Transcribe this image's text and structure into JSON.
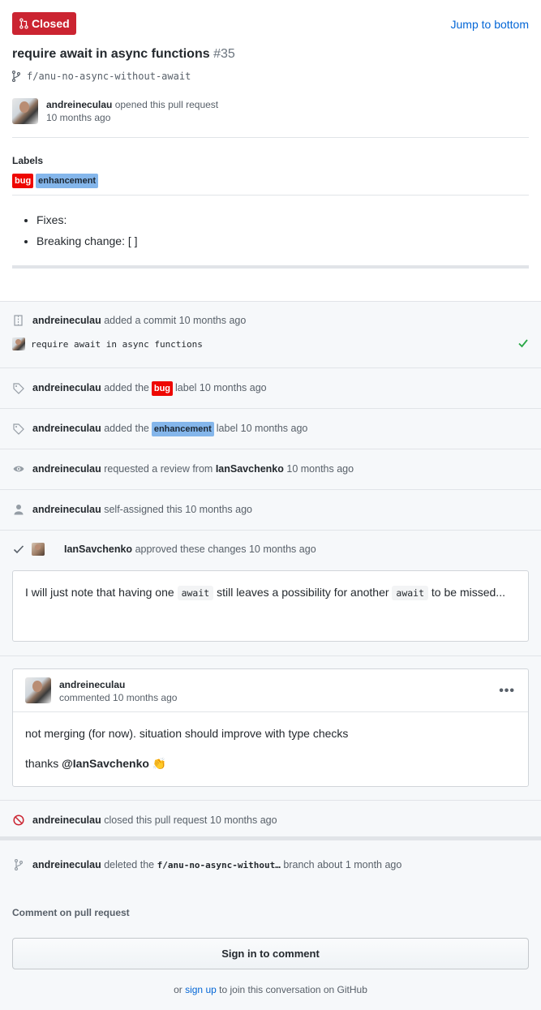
{
  "pr": {
    "state": "Closed",
    "jump": "Jump to bottom",
    "title": "require await in async functions",
    "number": "#35",
    "branch": "f/anu-no-async-without-await",
    "author": "andreineculau",
    "opened_text": "opened this pull request",
    "opened_time": "10 months ago"
  },
  "labels": {
    "heading": "Labels",
    "bug": "bug",
    "enhancement": "enhancement"
  },
  "body": {
    "items": [
      "Fixes:",
      "Breaking change: [ ]"
    ]
  },
  "timeline": {
    "commit": {
      "user": "andreineculau",
      "text": "added a commit 10 months ago",
      "message": "require await in async functions"
    },
    "label_bug": {
      "user": "andreineculau",
      "pre": "added the",
      "label": "bug",
      "post": "label 10 months ago"
    },
    "label_enh": {
      "user": "andreineculau",
      "pre": "added the",
      "label": "enhancement",
      "post": "label 10 months ago"
    },
    "review_req": {
      "user": "andreineculau",
      "pre": "requested a review from",
      "reviewer": "IanSavchenko",
      "post": "10 months ago"
    },
    "assigned": {
      "user": "andreineculau",
      "text": "self-assigned this 10 months ago"
    },
    "approved": {
      "user": "IanSavchenko",
      "text": "approved these changes 10 months ago"
    },
    "review_body": {
      "t1": "I will just note that having one",
      "code1": "await",
      "t2": "still leaves a possibility for another",
      "code2": "await",
      "t3": "to be",
      "t4": "missed..."
    },
    "comment": {
      "user": "andreineculau",
      "time": "commented 10 months ago",
      "menu": "•••",
      "line1": "not merging (for now). situation should improve with type checks",
      "thanks": "thanks",
      "mention": "@IanSavchenko",
      "emoji": "👏"
    },
    "closed": {
      "user": "andreineculau",
      "text": "closed this pull request 10 months ago"
    },
    "deleted": {
      "user": "andreineculau",
      "pre": "deleted the",
      "branch": "f/anu-no-async-without…",
      "post": "branch about 1 month ago"
    }
  },
  "footer": {
    "heading": "Comment on pull request",
    "sign_in": "Sign in to comment",
    "or": "or",
    "sign_up": "sign up",
    "join": "to join this conversation on GitHub"
  },
  "colors": {
    "closed": "#cb2431",
    "bug": "#ee0701",
    "enhancement": "#84b6eb",
    "link": "#0366d6",
    "check": "#28a745"
  }
}
